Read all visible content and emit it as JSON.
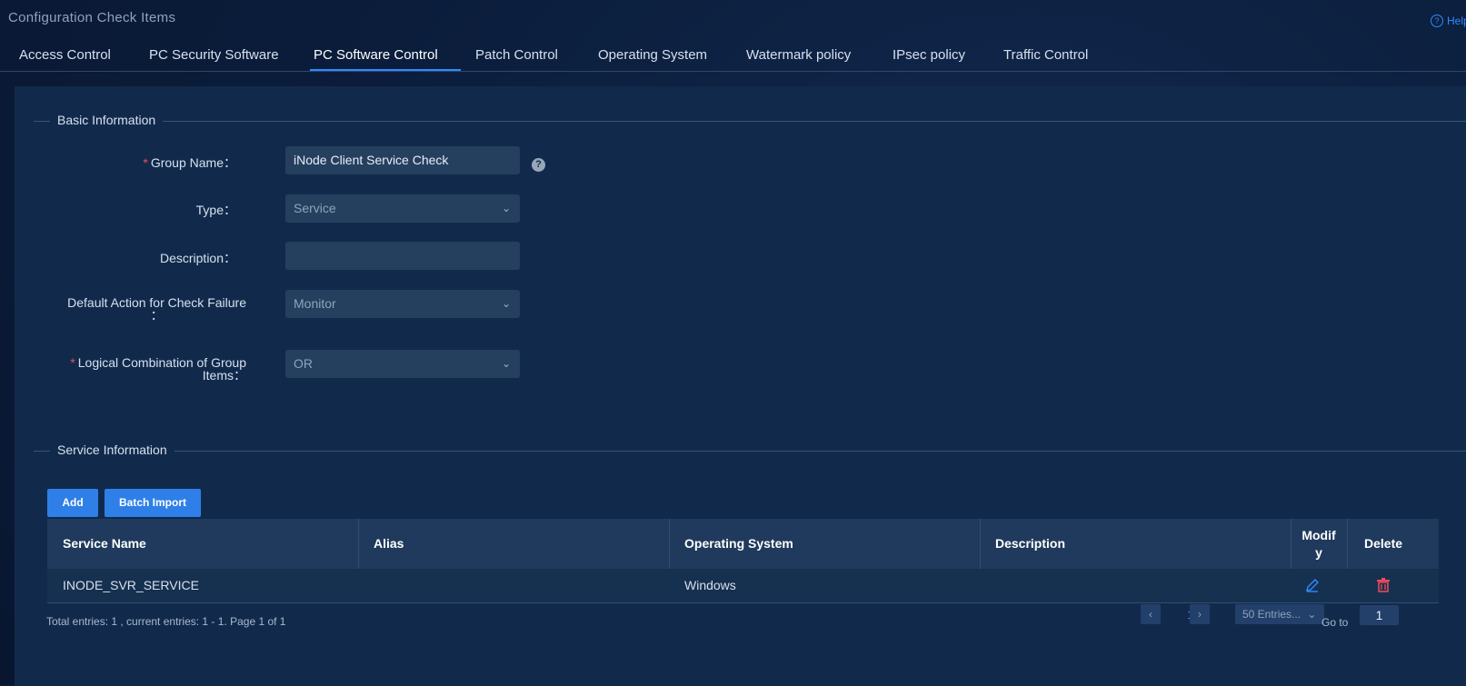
{
  "page": {
    "title": "Configuration Check Items",
    "help_label": "Help"
  },
  "tabs": [
    {
      "label": "Access Control"
    },
    {
      "label": "PC Security Software"
    },
    {
      "label": "PC Software Control",
      "active": true
    },
    {
      "label": "Patch Control"
    },
    {
      "label": "Operating System"
    },
    {
      "label": "Watermark policy"
    },
    {
      "label": "IPsec policy"
    },
    {
      "label": "Traffic Control"
    }
  ],
  "basic_info": {
    "title": "Basic Information",
    "group_name": {
      "label": "Group Name：",
      "value": "iNode Client Service Check",
      "hint": "?"
    },
    "type": {
      "label": "Type：",
      "value": "Service"
    },
    "description": {
      "label": "Description：",
      "value": ""
    },
    "default_action": {
      "label_line1": "Default Action for Check Failure",
      "label_line2": "：",
      "value": "Monitor"
    },
    "logical_combination": {
      "label_line1": "Logical Combination of Group",
      "label_line2": "Items：",
      "value": "OR"
    }
  },
  "service_info": {
    "title": "Service Information",
    "add_label": "Add",
    "batch_import_label": "Batch Import",
    "columns": {
      "service_name": "Service Name",
      "alias": "Alias",
      "os": "Operating System",
      "description": "Description",
      "modify_line1": "Modif",
      "modify_line2": "y",
      "delete": "Delete"
    },
    "rows": [
      {
        "service_name": "INODE_SVR_SERVICE",
        "alias": "",
        "os": "Windows",
        "description": ""
      }
    ]
  },
  "pagination": {
    "summary": "Total entries: 1 , current entries: 1 - 1. Page 1 of 1",
    "current_page": "1",
    "page_size": "50 Entries...",
    "goto_label": "Go to",
    "goto_value": "1"
  },
  "colors": {
    "accent": "#2e8bff",
    "danger": "#f04b5a",
    "background": "#0b1d3b",
    "panel": "#112a4c"
  }
}
